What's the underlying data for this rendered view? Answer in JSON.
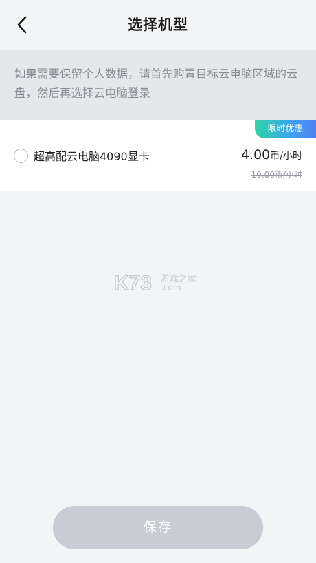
{
  "header": {
    "title": "选择机型",
    "back_icon": "chevron-left-icon"
  },
  "notice": {
    "text": "如果需要保留个人数据，请首先购置目标云电脑区域的云盘，然后再选择云电脑登录"
  },
  "machine": {
    "badge": "限时优惠",
    "name": "超高配云电脑4090显卡",
    "price_value": "4.00",
    "price_unit": "币/小时",
    "original_price": "10.00币/小时",
    "selected": false
  },
  "watermark": {
    "brand": "K73",
    "sub": "游戏之家",
    "domain": ".com"
  },
  "footer": {
    "save_label": "保存"
  },
  "colors": {
    "background": "#f3f4f6",
    "notice_bg": "#e6e7ea",
    "badge_gradient_start": "#2ed4a8",
    "badge_gradient_end": "#4f7ff2",
    "save_disabled": "#c9ccd3"
  }
}
